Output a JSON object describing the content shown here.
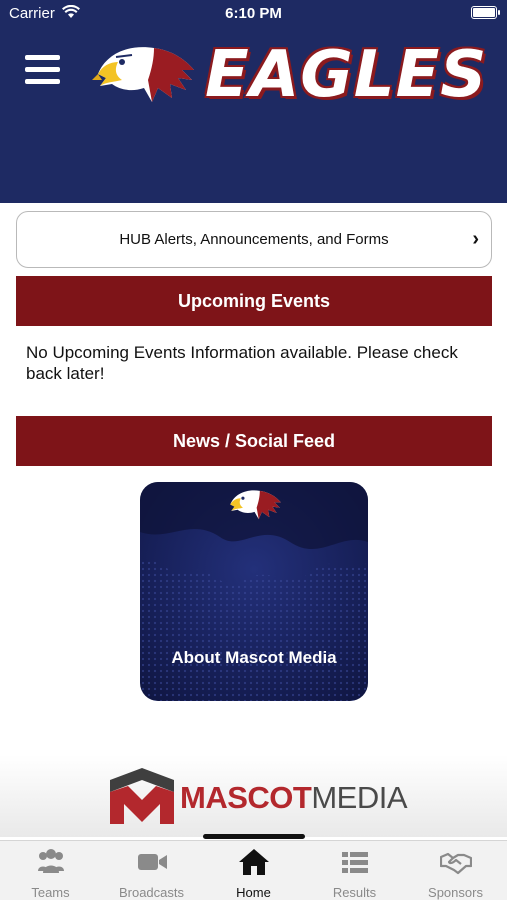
{
  "status_bar": {
    "carrier": "Carrier",
    "time": "6:10 PM"
  },
  "header": {
    "brand_title": "EAGLES",
    "menu_icon": "hamburger-icon",
    "logo_icon": "eagle-head-logo"
  },
  "hub": {
    "label": "HUB Alerts, Announcements, and Forms",
    "chevron_icon": "chevron-right-icon"
  },
  "upcoming_events": {
    "title": "Upcoming Events",
    "message": "No Upcoming Events Information available. Please check back later!"
  },
  "news": {
    "title": "News / Social Feed",
    "cards": [
      {
        "label": "About Mascot Media"
      }
    ]
  },
  "sponsor": {
    "brand_bold": "MASCOT",
    "brand_light": "MEDIA"
  },
  "tabs": [
    {
      "label": "Teams",
      "icon": "people-icon"
    },
    {
      "label": "Broadcasts",
      "icon": "video-camera-icon"
    },
    {
      "label": "Home",
      "icon": "home-icon",
      "active": true
    },
    {
      "label": "Results",
      "icon": "list-icon"
    },
    {
      "label": "Sponsors",
      "icon": "handshake-icon"
    }
  ],
  "colors": {
    "header_bg": "#1e2a63",
    "section_bar": "#7e1418",
    "brand_red": "#b3282d"
  }
}
